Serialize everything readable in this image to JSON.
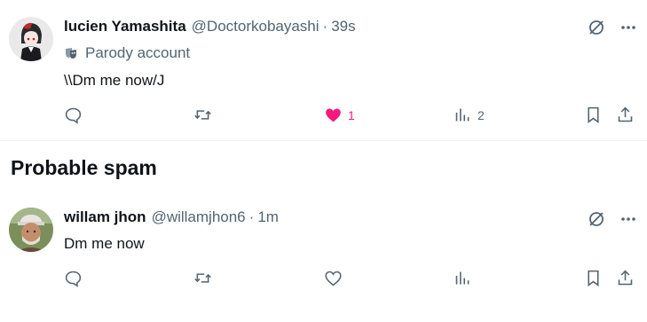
{
  "tweets": [
    {
      "name": "lucien Yamashita",
      "handle": "@Doctorkobayashi",
      "separator": "·",
      "time": "39s",
      "badge": "Parody account",
      "text": "\\\\Dm me now/J",
      "likes": "1",
      "views": "2",
      "liked": true
    },
    {
      "name": "willam jhon",
      "handle": "@willamjhon6",
      "separator": "·",
      "time": "1m",
      "text": "Dm me now",
      "likes": "",
      "views": "",
      "liked": false
    }
  ],
  "section_title": "Probable spam",
  "colors": {
    "like": "#f91880",
    "muted": "#536471",
    "text": "#0f1419"
  }
}
